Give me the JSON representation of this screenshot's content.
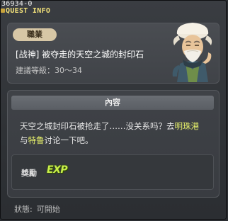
{
  "window": {
    "quest_id": "36934-0",
    "title": "QUEST INFO"
  },
  "header": {
    "job_badge": "職業",
    "quest_name": "[战神] 被夺走的天空之城的封印石",
    "level_label": "建議等級：30～34"
  },
  "content": {
    "section_title": "內容",
    "description_parts": [
      {
        "text": "天空之城封印石被抢走了……没关系吗？去",
        "highlight": false
      },
      {
        "text": "明珠港",
        "highlight": true
      },
      {
        "text": "与",
        "highlight": false
      },
      {
        "text": "特鲁",
        "highlight": true
      },
      {
        "text": "讨论一下吧。",
        "highlight": false
      }
    ],
    "reward_label": "獎勵",
    "reward_items": [
      {
        "icon": "exp-icon",
        "text": "EXP"
      }
    ]
  },
  "status": {
    "label": "狀態:",
    "value": "可開始"
  },
  "colors": {
    "title": "#f3e27a",
    "highlight": "#e8f26b",
    "exp": "#c9f04a"
  }
}
